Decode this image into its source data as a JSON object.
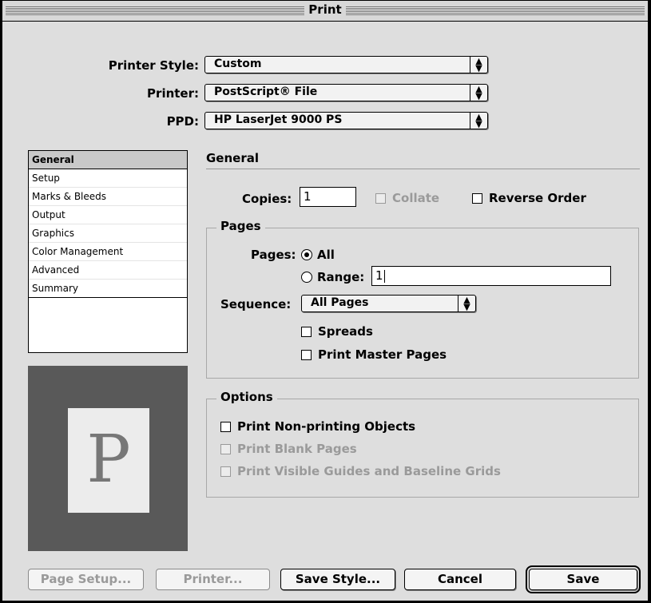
{
  "window": {
    "title": "Print"
  },
  "top": {
    "printer_style_label": "Printer Style:",
    "printer_style_value": "Custom",
    "printer_label": "Printer:",
    "printer_value": "PostScript® File",
    "ppd_label": "PPD:",
    "ppd_value": "HP LaserJet 9000 PS"
  },
  "sidebar": {
    "items": [
      {
        "label": "General",
        "selected": true
      },
      {
        "label": "Setup"
      },
      {
        "label": "Marks & Bleeds"
      },
      {
        "label": "Output"
      },
      {
        "label": "Graphics"
      },
      {
        "label": "Color Management"
      },
      {
        "label": "Advanced"
      },
      {
        "label": "Summary"
      }
    ]
  },
  "preview": {
    "letter": "P"
  },
  "general": {
    "title": "General",
    "copies_label": "Copies:",
    "copies_value": "1",
    "collate_label": "Collate",
    "reverse_order_label": "Reverse Order"
  },
  "pages": {
    "group_title": "Pages",
    "pages_label": "Pages:",
    "all_label": "All",
    "range_label": "Range:",
    "range_value": "1",
    "sequence_label": "Sequence:",
    "sequence_value": "All Pages",
    "spreads_label": "Spreads",
    "print_master_pages_label": "Print Master Pages"
  },
  "options": {
    "group_title": "Options",
    "non_printing_label": "Print Non-printing Objects",
    "blank_pages_label": "Print Blank Pages",
    "guides_label": "Print Visible Guides and Baseline Grids"
  },
  "buttons": {
    "page_setup": "Page Setup...",
    "printer": "Printer...",
    "save_style": "Save Style...",
    "cancel": "Cancel",
    "save": "Save"
  }
}
